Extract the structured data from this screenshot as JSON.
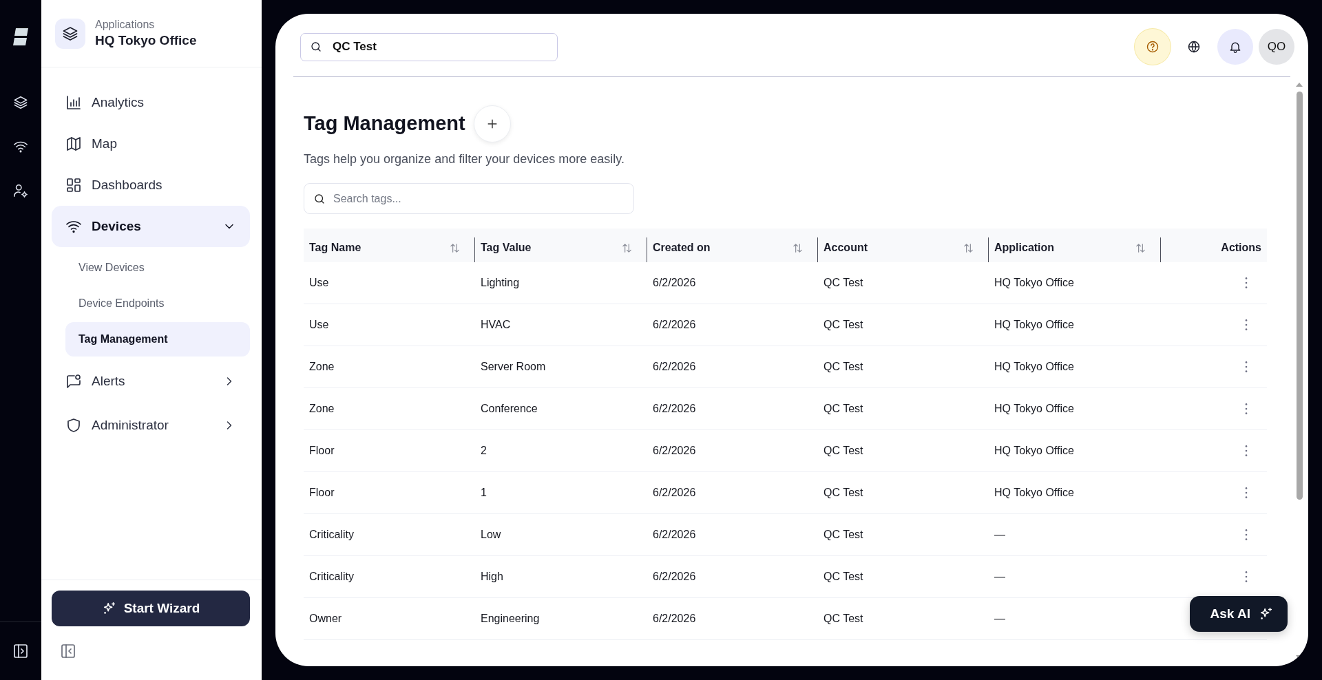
{
  "application": {
    "label": "Applications",
    "name": "HQ Tokyo Office"
  },
  "nav": [
    {
      "label": "Analytics",
      "selected": false
    },
    {
      "label": "Map",
      "selected": false
    },
    {
      "label": "Dashboards",
      "selected": false
    },
    {
      "label": "Devices",
      "selected": true,
      "expanded": true,
      "children": [
        {
          "label": "View Devices",
          "selected": false
        },
        {
          "label": "Device Endpoints",
          "selected": false
        },
        {
          "label": "Tag Management",
          "selected": true
        }
      ]
    },
    {
      "label": "Alerts",
      "selected": false,
      "expanded": false
    },
    {
      "label": "Administrator",
      "selected": false,
      "expanded": false
    }
  ],
  "wizard_button": "Start Wizard",
  "search": {
    "value": "QC Test"
  },
  "avatar": "QO",
  "page": {
    "title": "Tag Management",
    "subtitle": "Tags help you organize and filter your devices more easily."
  },
  "tag_search": {
    "placeholder": "Search tags..."
  },
  "table": {
    "columns": [
      {
        "label": "Tag Name",
        "sortable": true
      },
      {
        "label": "Tag Value",
        "sortable": true
      },
      {
        "label": "Created on",
        "sortable": true
      },
      {
        "label": "Account",
        "sortable": true
      },
      {
        "label": "Application",
        "sortable": true
      },
      {
        "label": "Actions",
        "sortable": false
      }
    ],
    "rows": [
      [
        "Use",
        "Lighting",
        "6/2/2026",
        "QC Test",
        "HQ Tokyo Office"
      ],
      [
        "Use",
        "HVAC",
        "6/2/2026",
        "QC Test",
        "HQ Tokyo Office"
      ],
      [
        "Zone",
        "Server Room",
        "6/2/2026",
        "QC Test",
        "HQ Tokyo Office"
      ],
      [
        "Zone",
        "Conference",
        "6/2/2026",
        "QC Test",
        "HQ Tokyo Office"
      ],
      [
        "Floor",
        "2",
        "6/2/2026",
        "QC Test",
        "HQ Tokyo Office"
      ],
      [
        "Floor",
        "1",
        "6/2/2026",
        "QC Test",
        "HQ Tokyo Office"
      ],
      [
        "Criticality",
        "Low",
        "6/2/2026",
        "QC Test",
        "—"
      ],
      [
        "Criticality",
        "High",
        "6/2/2026",
        "QC Test",
        "—"
      ],
      [
        "Owner",
        "Engineering",
        "6/2/2026",
        "QC Test",
        "—"
      ]
    ]
  },
  "ask_ai": "Ask AI"
}
